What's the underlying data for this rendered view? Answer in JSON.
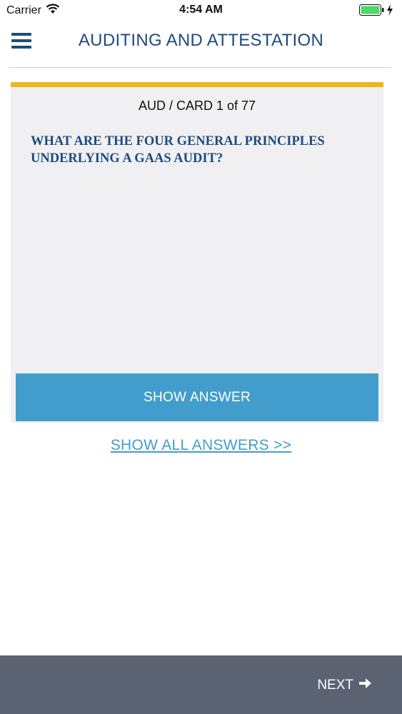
{
  "status": {
    "carrier": "Carrier",
    "time": "4:54 AM"
  },
  "header": {
    "title": "AUDITING AND ATTESTATION"
  },
  "card": {
    "counter": "AUD / CARD 1 of 77",
    "question": "WHAT ARE THE FOUR GENERAL PRINCIPLES UNDERLYING A GAAS AUDIT?",
    "show_answer_label": "SHOW ANSWER"
  },
  "links": {
    "show_all": "SHOW ALL ANSWERS >>"
  },
  "footer": {
    "next_label": "NEXT"
  },
  "colors": {
    "primary": "#1e4a7d",
    "accent": "#429dcc",
    "card_top": "#f0b41e",
    "footer_bg": "#5b6271",
    "battery": "#4cd964"
  },
  "icons": {
    "menu": "hamburger-menu-icon",
    "next": "arrow-right-icon",
    "wifi": "wifi-icon",
    "battery": "battery-icon",
    "charging": "charging-bolt-icon"
  }
}
